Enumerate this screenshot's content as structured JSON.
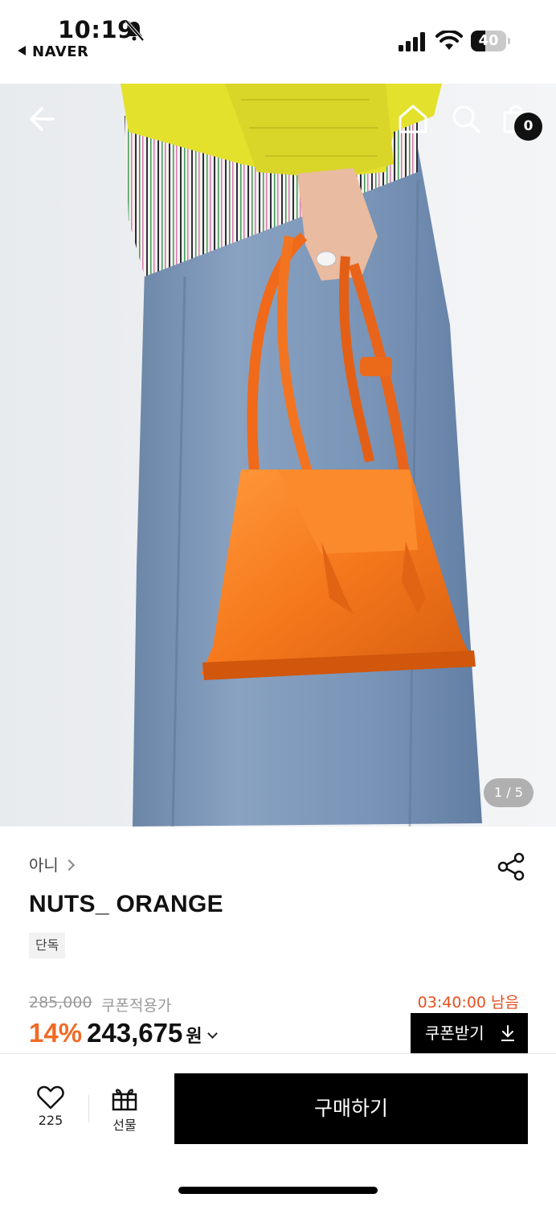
{
  "status_bar": {
    "time": "10:19",
    "back_app": "NAVER",
    "battery_level": 40,
    "battery_label": "40",
    "icons": [
      "bell-slash-icon",
      "cellular-signal-icon",
      "wifi-icon",
      "battery-icon"
    ]
  },
  "header": {
    "icons": [
      "arrow-left-icon",
      "home-icon",
      "search-icon",
      "shopping-bag-icon"
    ],
    "cart_count": "0"
  },
  "gallery": {
    "pager": "1 / 5"
  },
  "product": {
    "brand": "아니",
    "name": "NUTS_ ORANGE",
    "tag": "단독",
    "original_price": "285,000",
    "coupon_label": "쿠폰적용가",
    "countdown": "03:40:00 남음",
    "discount": "14%",
    "price": "243,675",
    "currency": "원",
    "coupon_button": "쿠폰받기"
  },
  "bottom_bar": {
    "like_count": "225",
    "gift_label": "선물",
    "buy_label": "구매하기"
  },
  "colors": {
    "accent_orange": "#f06a24",
    "timer_red": "#e6501e",
    "black": "#000000"
  }
}
